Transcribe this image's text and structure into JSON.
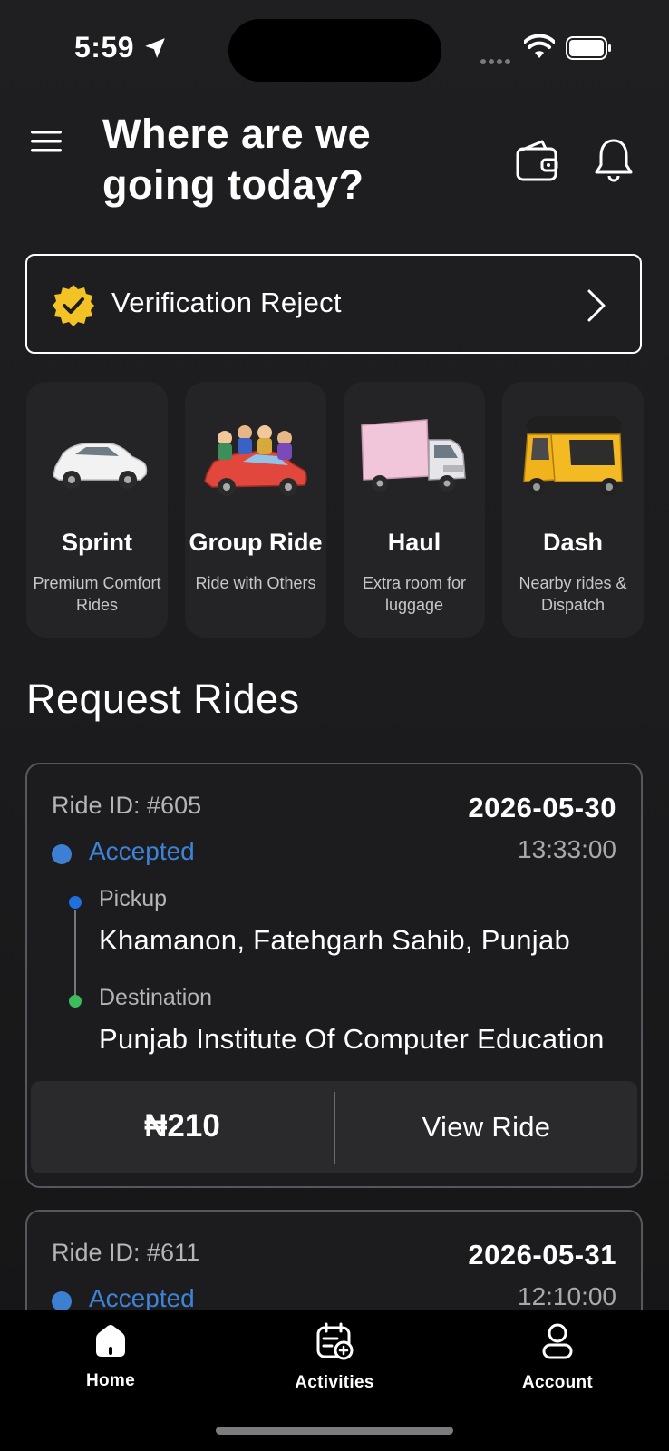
{
  "status_bar": {
    "time": "5:59"
  },
  "header": {
    "title": "Where are we going today?"
  },
  "verification": {
    "label": "Verification Reject",
    "badge_color": "#f3c326"
  },
  "categories": [
    {
      "name": "Sprint",
      "desc": "Premium Comfort Rides",
      "icon": "white-car"
    },
    {
      "name": "Group Ride",
      "desc": "Ride with Others",
      "icon": "red-car-with-passengers"
    },
    {
      "name": "Haul",
      "desc": "Extra room for luggage",
      "icon": "pink-truck"
    },
    {
      "name": "Dash",
      "desc": "Nearby rides & Dispatch",
      "icon": "yellow-auto-rickshaw"
    }
  ],
  "section": {
    "title": "Request Rides"
  },
  "rides": [
    {
      "id": "Ride ID: #605",
      "date": "2026-05-30",
      "time": "13:33:00",
      "status": "Accepted",
      "pickup_label": "Pickup",
      "pickup": "Khamanon, Fatehgarh Sahib, Punjab",
      "destination_label": "Destination",
      "destination": "Punjab Institute Of Computer Education",
      "fare": "₦210",
      "action": "View Ride"
    },
    {
      "id": "Ride ID: #611",
      "date": "2026-05-31",
      "time": "12:10:00",
      "status": "Accepted"
    }
  ],
  "tabs": [
    {
      "label": "Home",
      "icon": "home-icon"
    },
    {
      "label": "Activities",
      "icon": "calendar-icon"
    },
    {
      "label": "Account",
      "icon": "user-icon"
    }
  ],
  "colors": {
    "accent_blue": "#3d83d8",
    "pickup_dot": "#1f6fe0",
    "destination_dot": "#3dbb5a",
    "background": "#1c1c1e"
  }
}
